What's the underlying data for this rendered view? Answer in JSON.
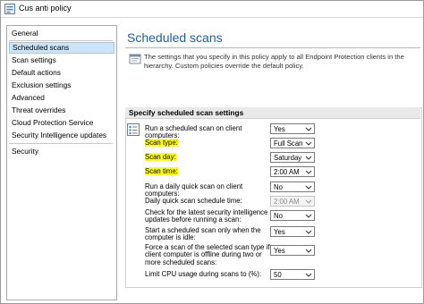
{
  "window": {
    "title": "Cus anti policy"
  },
  "sidebar": {
    "items": [
      {
        "label": "General"
      },
      {
        "label": "Scheduled scans",
        "selected": true
      },
      {
        "label": "Scan settings"
      },
      {
        "label": "Default actions"
      },
      {
        "label": "Exclusion settings"
      },
      {
        "label": "Advanced"
      },
      {
        "label": "Threat overrides"
      },
      {
        "label": "Cloud Protection Service"
      },
      {
        "label": "Security Intelligence updates"
      },
      {
        "label": "Security"
      }
    ]
  },
  "main": {
    "heading": "Scheduled scans",
    "info": "The settings that you specify in this policy apply to all Endpoint Protection clients in the hierarchy. Custom policies override the default policy.",
    "group_title": "Specify scheduled scan settings",
    "settings": [
      {
        "label": "Run a scheduled scan on client computers:",
        "value": "Yes",
        "enabled": true,
        "highlight": false
      },
      {
        "label": "Scan type:",
        "value": "Full Scan",
        "enabled": true,
        "highlight": true
      },
      {
        "label": "Scan day:",
        "value": "Saturday",
        "enabled": true,
        "highlight": true
      },
      {
        "label": "Scan time:",
        "value": "2:00 AM",
        "enabled": true,
        "highlight": true
      },
      {
        "label": "Run a daily quick scan on client computers:",
        "value": "No",
        "enabled": true,
        "highlight": false
      },
      {
        "label": "Daily quick scan schedule time:",
        "value": "2:00 AM",
        "enabled": false,
        "highlight": false
      },
      {
        "label": "Check for the latest security intelligence updates before running a scan:",
        "value": "No",
        "enabled": true,
        "highlight": false
      },
      {
        "label": "Start a scheduled scan only when the computer is idle:",
        "value": "Yes",
        "enabled": true,
        "highlight": false
      },
      {
        "label": "Force a scan of the selected scan type if client computer is offline during two or more scheduled scans:",
        "value": "Yes",
        "enabled": true,
        "highlight": false
      },
      {
        "label": "Limit CPU usage during scans to (%):",
        "value": "50",
        "enabled": true,
        "highlight": false
      }
    ]
  }
}
